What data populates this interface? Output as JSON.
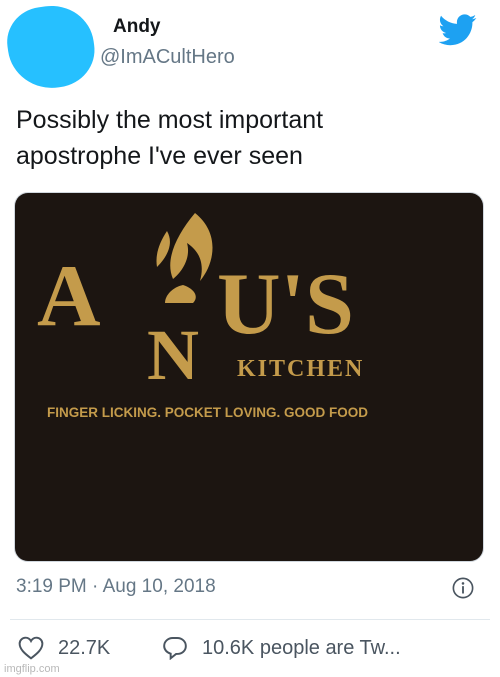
{
  "author": {
    "name": "Andy",
    "handle": "@ImACultHero",
    "avatar_color": "#26c0ff"
  },
  "brand_icon": "twitter-bird-icon",
  "tweet": {
    "line1": "Possibly the most important",
    "line2": "apostrophe I've ever seen"
  },
  "image_sign": {
    "brand_a": "A",
    "brand_n": "N",
    "brand_us": "U'S",
    "kitchen": "KITCHEN",
    "tagline": "FINGER LICKING. POCKET LOVING. GOOD FOOD",
    "background_color": "#17120f",
    "text_color": "#c49b4b"
  },
  "meta": {
    "timestamp": "3:19 PM · Aug 10, 2018",
    "info_icon": "info-icon"
  },
  "actions": {
    "likes": "22.7K",
    "talking": "10.6K people are Tw..."
  },
  "watermark": "imgflip.com",
  "colors": {
    "twitter_blue": "#1da1f2",
    "secondary_text": "#657786"
  }
}
